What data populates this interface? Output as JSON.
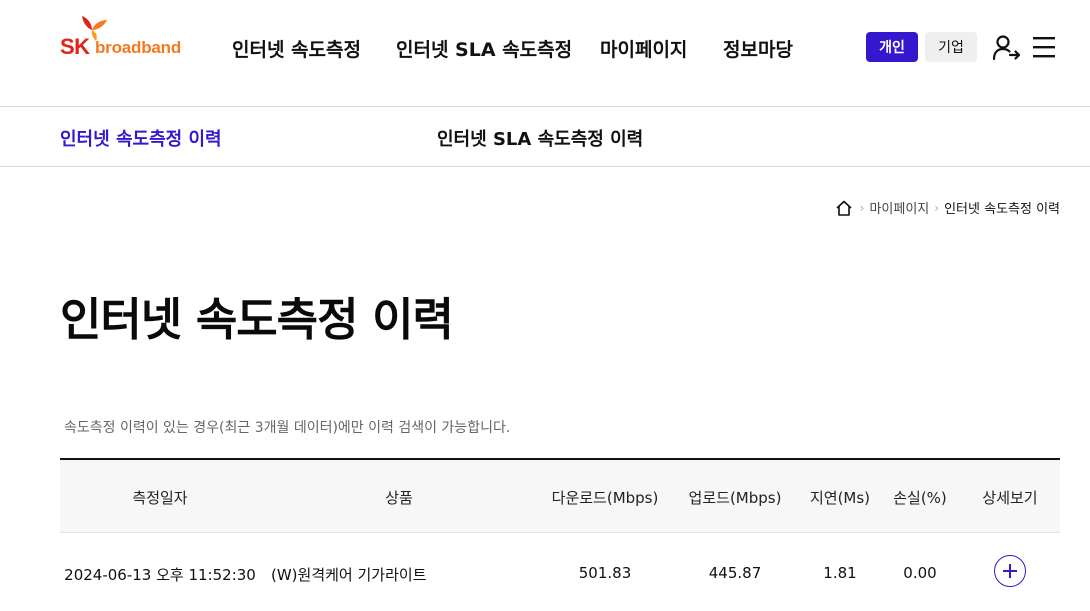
{
  "brand": {
    "sk": "SK",
    "broadband": "broadband"
  },
  "gnb": {
    "items": [
      "인터넷 속도측정",
      "인터넷 SLA 속도측정",
      "마이페이지",
      "정보마당"
    ]
  },
  "segments": {
    "personal": "개인",
    "business": "기업"
  },
  "subnav": {
    "active": "인터넷 속도측정 이력",
    "other": "인터넷 SLA 속도측정 이력"
  },
  "breadcrumb": {
    "mypage": "마이페이지",
    "current": "인터넷 속도측정 이력"
  },
  "page": {
    "title": "인터넷 속도측정 이력",
    "notice": "속도측정 이력이 있는 경우(최근 3개월 데이터)에만 이력 검색이 가능합니다."
  },
  "table": {
    "headers": [
      "측정일자",
      "상품",
      "다운로드(Mbps)",
      "업로드(Mbps)",
      "지연(Ms)",
      "손실(%)",
      "상세보기"
    ],
    "rows": [
      {
        "date": "2024-06-13 오후 11:52:30",
        "product": "(W)원격케어 기가라이트",
        "download": "501.83",
        "upload": "445.87",
        "latency": "1.81",
        "loss": "0.00"
      }
    ]
  },
  "colors": {
    "accent": "#3617ce",
    "brand_red": "#e2231a",
    "brand_orange": "#f47920"
  }
}
